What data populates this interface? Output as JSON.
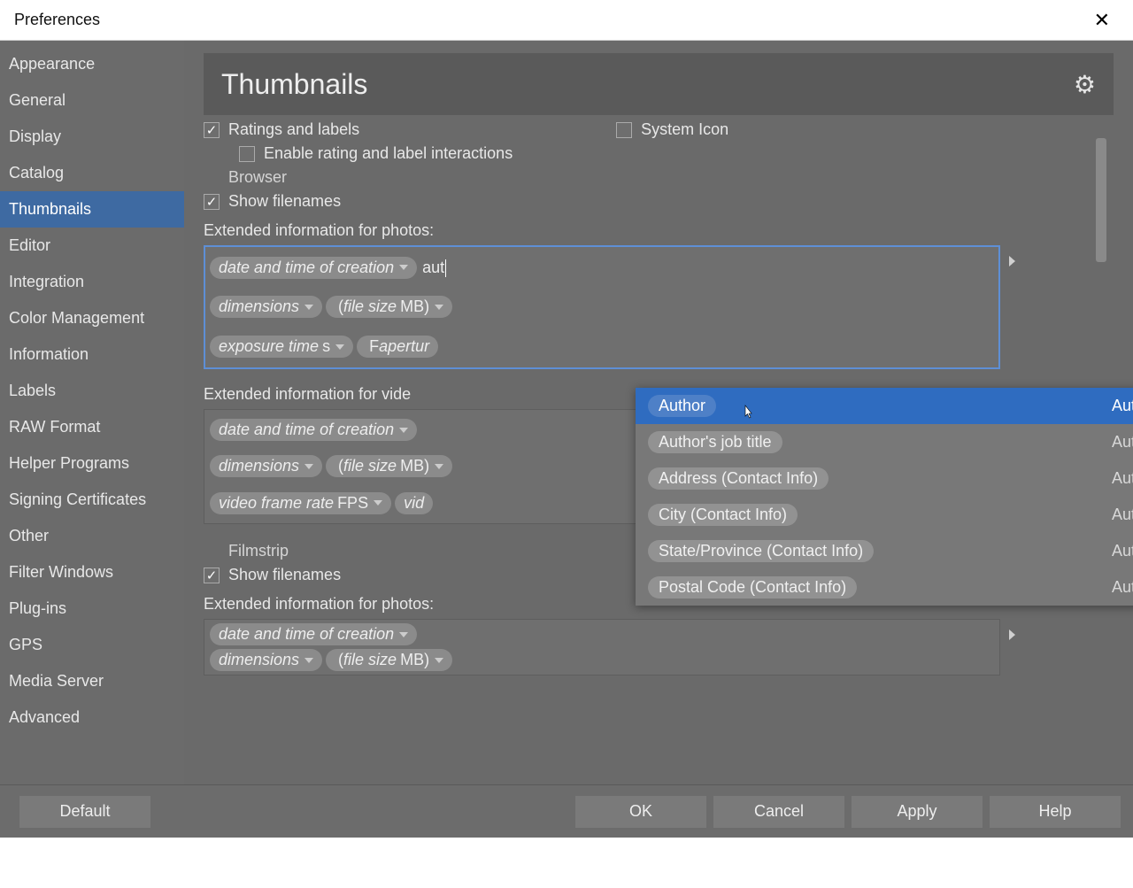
{
  "window": {
    "title": "Preferences"
  },
  "sidebar": {
    "items": [
      "Appearance",
      "General",
      "Display",
      "Catalog",
      "Thumbnails",
      "Editor",
      "Integration",
      "Color Management",
      "Information",
      "Labels",
      "RAW Format",
      "Helper Programs",
      "Signing Certificates",
      "Other",
      "Filter Windows",
      "Plug-ins",
      "GPS",
      "Media Server",
      "Advanced"
    ],
    "selected_index": 4
  },
  "panel": {
    "title": "Thumbnails"
  },
  "options": {
    "ratings_labels": "Ratings and labels",
    "system_icon": "System Icon",
    "enable_rating": "Enable rating and label interactions",
    "browser_section": "Browser",
    "show_filenames": "Show filenames",
    "ext_photos_label": "Extended information for photos:",
    "ext_video_label": "Extended information for vide",
    "filmstrip_section": "Filmstrip",
    "show_filenames2": "Show filenames",
    "ext_photos_label2": "Extended information for photos:"
  },
  "photo_tags": {
    "line1": [
      {
        "text": "date and time of creation",
        "caret": true
      }
    ],
    "typed": "aut",
    "line2": [
      {
        "text": "dimensions",
        "caret": true
      },
      {
        "prefix": "(",
        "text": "file size",
        "suffix": " MB)",
        "caret": true
      }
    ],
    "line3": [
      {
        "text": "exposure time",
        "suffix": " s",
        "caret": true
      },
      {
        "prefix": "F",
        "text": "apertur",
        "caret": false
      }
    ]
  },
  "video_tags": {
    "line1": [
      {
        "text": "date and time of creation",
        "caret": true
      }
    ],
    "line2": [
      {
        "text": "dimensions",
        "caret": true
      },
      {
        "prefix": "(",
        "text": "file size",
        "suffix": " MB)",
        "caret": true
      }
    ],
    "line3": [
      {
        "text": "video frame rate",
        "suffix": " FPS",
        "caret": true
      },
      {
        "text": "vid",
        "caret": false
      }
    ]
  },
  "film_tags": {
    "line1": [
      {
        "text": "date and time of creation",
        "caret": true
      }
    ],
    "line2": [
      {
        "text": "dimensions",
        "caret": true
      },
      {
        "prefix": "(",
        "text": "file size",
        "suffix": " MB)",
        "caret": true
      }
    ]
  },
  "autocomplete": {
    "items": [
      {
        "label": "Author",
        "category": "Author",
        "highlight": true
      },
      {
        "label": "Author's job title",
        "category": "Author"
      },
      {
        "label": "Address (Contact Info)",
        "category": "Author"
      },
      {
        "label": "City (Contact Info)",
        "category": "Author"
      },
      {
        "label": "State/Province (Contact Info)",
        "category": "Author"
      },
      {
        "label": "Postal Code (Contact Info)",
        "category": "Author"
      }
    ]
  },
  "footer": {
    "default": "Default",
    "ok": "OK",
    "cancel": "Cancel",
    "apply": "Apply",
    "help": "Help"
  }
}
